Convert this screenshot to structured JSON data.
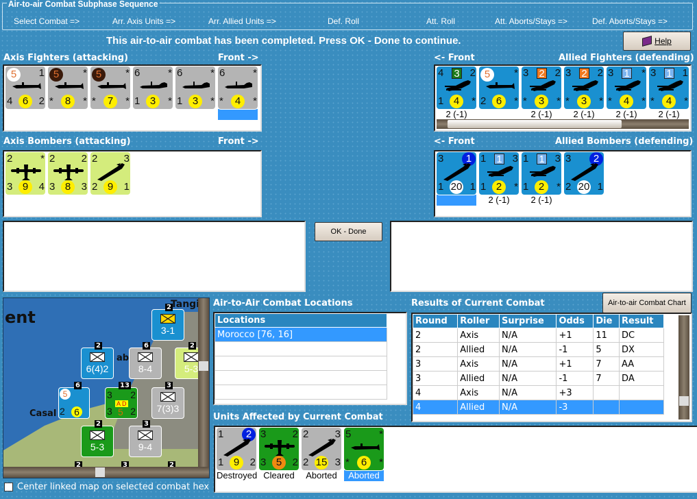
{
  "sequence": {
    "title": "Air-to-air Combat Subphase Sequence",
    "steps": [
      "Select Combat =>",
      "Arr. Axis Units =>",
      "Arr. Allied Units =>",
      "Def. Roll",
      "Att. Roll",
      "Att. Aborts/Stays =>",
      "Def. Aborts/Stays =>"
    ]
  },
  "message": "This air-to-air combat has been completed.  Press OK - Done to continue.",
  "help_label": "Help",
  "axis_fighters": {
    "title": "Axis Fighters (attacking)",
    "front": "Front ->",
    "units": [
      {
        "tl": "5",
        "tl_style": "white",
        "tr": "1",
        "bl": "4",
        "c": "6",
        "br": "2",
        "bg": "#b4b4b4",
        "plane": "fighter2"
      },
      {
        "tl": "5",
        "tl_style": "dark",
        "tr": "*",
        "bl": "*",
        "c": "8",
        "br": "*",
        "bg": "#b4b4b4",
        "plane": "fighter2"
      },
      {
        "tl": "5",
        "tl_style": "dark",
        "tr": "*",
        "bl": "*",
        "c": "7",
        "br": "*",
        "bg": "#b4b4b4",
        "plane": "fighter2"
      },
      {
        "tl": "6",
        "tr": "*",
        "bl": "1",
        "c": "3",
        "br": "*",
        "bg": "#b4b4b4",
        "plane": "fighter"
      },
      {
        "tl": "6",
        "tr": "*",
        "bl": "1",
        "c": "3",
        "br": "*",
        "bg": "#b4b4b4",
        "plane": "fighter"
      },
      {
        "tl": "6",
        "tr": "*",
        "bl": "*",
        "c": "4",
        "br": "*",
        "bg": "#b4b4b4",
        "plane": "fighter",
        "selected": true
      }
    ]
  },
  "allied_fighters": {
    "title": "Allied Fighters (defending)",
    "front": "<- Front",
    "units": [
      {
        "tl": "4",
        "badge": "3",
        "badge_color": "#1a7a1a",
        "tr": "2",
        "bl": "1",
        "c": "4",
        "br": "*",
        "bg": "#1a90d0",
        "plane": "biplane",
        "label": "2 (-1)"
      },
      {
        "tl": "5",
        "tl_style": "white",
        "tr": "*",
        "bl": "2",
        "c": "6",
        "br": "*",
        "bg": "#1a90d0",
        "plane": "fighter2",
        "label": ""
      },
      {
        "tl": "3",
        "badge": "2",
        "badge_color": "#f07a20",
        "tr": "2",
        "bl": "*",
        "c": "3",
        "br": "*",
        "bg": "#1a90d0",
        "plane": "biplane",
        "label": "2 (-1)"
      },
      {
        "tl": "3",
        "badge": "2",
        "badge_color": "#f07a20",
        "tr": "2",
        "bl": "*",
        "c": "3",
        "br": "*",
        "bg": "#1a90d0",
        "plane": "biplane",
        "label": "2 (-1)"
      },
      {
        "tl": "3",
        "badge": "1",
        "badge_color": "#7ab4f0",
        "tr": "*",
        "bl": "*",
        "c": "4",
        "br": "*",
        "bg": "#1a90d0",
        "plane": "biplane",
        "label": "2 (-1)"
      },
      {
        "tl": "3",
        "badge": "1",
        "badge_color": "#7ab4f0",
        "tr": "1",
        "bl": "*",
        "c": "4",
        "br": "*",
        "bg": "#1a90d0",
        "plane": "biplane",
        "label": "2 (-1)"
      }
    ]
  },
  "axis_bombers": {
    "title": "Axis Bombers (attacking)",
    "front": "Front ->",
    "units": [
      {
        "tl": "2",
        "tr": "*",
        "bl": "3",
        "c": "9",
        "br": "4",
        "bg": "#d4ec7c",
        "plane": "bomber"
      },
      {
        "tl": "2",
        "tr": "2",
        "bl": "3",
        "c": "8",
        "br": "3",
        "bg": "#d4ec7c",
        "plane": "bomber"
      },
      {
        "tl": "2",
        "tr": "3",
        "bl": "2",
        "c": "9",
        "br": "1",
        "bg": "#d4ec7c",
        "plane": "dive"
      }
    ]
  },
  "allied_bombers": {
    "title": "Allied Bombers (defending)",
    "front": "<- Front",
    "units": [
      {
        "tl": "3",
        "corner": "1",
        "bl": "1",
        "c": "20",
        "c_style": "white",
        "br": "1",
        "bg": "#1a90d0",
        "plane": "dive",
        "selected": true,
        "label": ""
      },
      {
        "tl": "1",
        "badge": "1",
        "badge_color": "#7ab4f0",
        "tr": "3",
        "bl": "1",
        "c": "2",
        "br": "*",
        "bg": "#1a90d0",
        "plane": "biplane",
        "label": "2 (-1)"
      },
      {
        "tl": "1",
        "badge": "1",
        "badge_color": "#7ab4f0",
        "tr": "3",
        "bl": "1",
        "c": "2",
        "br": "*",
        "bg": "#1a90d0",
        "plane": "biplane",
        "label": "2 (-1)"
      },
      {
        "tl": "3",
        "corner": "2",
        "bl": "2",
        "c": "20",
        "c_style": "white",
        "br": "1",
        "bg": "#1a90d0",
        "plane": "dive",
        "label": ""
      }
    ]
  },
  "ok_label": "OK - Done",
  "locations": {
    "title": "Air-to-Air Combat Locations",
    "header": "Locations",
    "rows": [
      "Morocco [76, 16]"
    ]
  },
  "results": {
    "title": "Results of Current Combat",
    "chart_button": "Air-to-air Combat Chart",
    "columns": [
      "Round",
      "Roller",
      "Surprise",
      "Odds",
      "Die",
      "Result"
    ],
    "rows": [
      [
        "2",
        "Axis",
        "N/A",
        "+1",
        "11",
        "DC"
      ],
      [
        "2",
        "Allied",
        "N/A",
        "-1",
        "5",
        "DX"
      ],
      [
        "3",
        "Axis",
        "N/A",
        "+1",
        "7",
        "AA"
      ],
      [
        "3",
        "Allied",
        "N/A",
        "-1",
        "7",
        "DA"
      ],
      [
        "4",
        "Axis",
        "N/A",
        "+3",
        "",
        ""
      ],
      [
        "4",
        "Allied",
        "N/A",
        "-3",
        "",
        ""
      ]
    ]
  },
  "affected": {
    "title": "Units Affected by Current Combat",
    "units": [
      {
        "tl": "1",
        "corner": "2",
        "bl": "1",
        "c": "9",
        "br": "2",
        "bg": "#b4b4b4",
        "plane": "dive",
        "label": "Destroyed"
      },
      {
        "tl": "3",
        "tr": "2",
        "bl": "3",
        "c": "5",
        "c_style": "orange",
        "br": "2",
        "bg": "#1a9a1a",
        "plane": "bomber",
        "label": "Cleared"
      },
      {
        "tl": "2",
        "tr": "3",
        "bl": "2",
        "c": "15",
        "br": "3",
        "bg": "#b4b4b4",
        "plane": "dive",
        "label": "Aborted"
      },
      {
        "tl": "5",
        "tr": "*",
        "bl": "*",
        "c": "6",
        "br": "*",
        "bg": "#1a9a1a",
        "plane": "fighter2",
        "label": "Aborted",
        "selected": true
      }
    ]
  },
  "map": {
    "title_fragment": "ent",
    "places": [
      "Tangi",
      "Casal",
      "ab"
    ],
    "counters": [
      {
        "text": "3-1",
        "top": "2"
      },
      {
        "text": "6(4)2",
        "top": "2"
      },
      {
        "text": "8-4",
        "top": "6"
      },
      {
        "text": "5-3",
        "top": "2"
      },
      {
        "text": "7(3)3",
        "top": "3"
      },
      {
        "text": "5-3",
        "top": "2"
      },
      {
        "text": "9-4",
        "top": "3"
      }
    ],
    "air_stack": {
      "tl": "3",
      "tr": "2",
      "bl": "3",
      "br": "2",
      "c": "5",
      "flag": "A D",
      "top": "13"
    },
    "air_unit": {
      "tl": "5",
      "bl": "2",
      "c": "6",
      "top": "6"
    },
    "edge_nums": [
      "2",
      "3",
      "2"
    ]
  },
  "center_checkbox": "Center linked map on selected combat hex"
}
